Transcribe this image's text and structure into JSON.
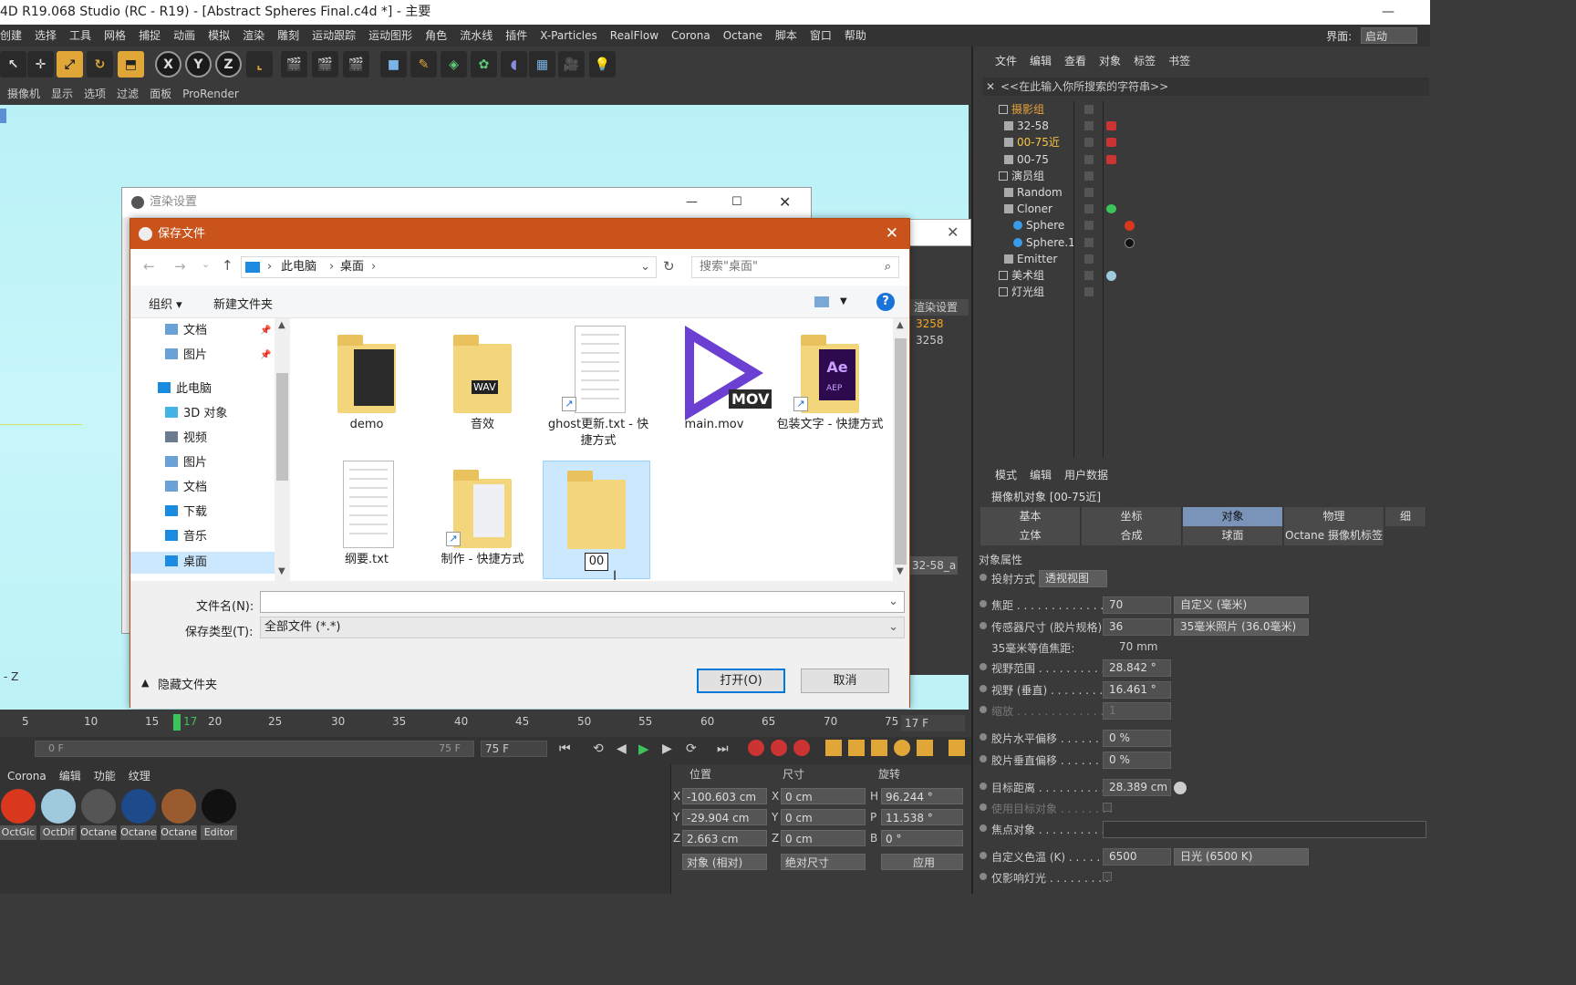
{
  "window": {
    "title": "4D R19.068 Studio (RC - R19) - [Abstract Spheres Final.c4d *] - 主要",
    "minimize": "—",
    "restore": "□"
  },
  "menu": {
    "items": [
      "创建",
      "选择",
      "工具",
      "网格",
      "捕捉",
      "动画",
      "模拟",
      "渲染",
      "雕刻",
      "运动跟踪",
      "运动图形",
      "角色",
      "流水线",
      "插件",
      "X-Particles",
      "RealFlow",
      "Corona",
      "Octane",
      "脚本",
      "窗口",
      "帮助"
    ],
    "layout_label": "界面:",
    "layout_value": "启动"
  },
  "toolbar": {
    "x": "X",
    "y": "Y",
    "z": "Z"
  },
  "viewmenu": [
    "摄像机",
    "显示",
    "选项",
    "过滤",
    "面板",
    "ProRender"
  ],
  "viewport": {
    "axis_label": "- Z"
  },
  "timeline": {
    "ticks": [
      "5",
      "10",
      "15",
      "17",
      "20",
      "25",
      "30",
      "35",
      "40",
      "45",
      "50",
      "55",
      "60",
      "65",
      "70",
      "75"
    ],
    "current_frame": "17 F",
    "range_start": "0 F",
    "range_end": "75 F",
    "end_field": "75 F"
  },
  "materials": {
    "menu": [
      "Corona",
      "编辑",
      "功能",
      "纹理"
    ],
    "items": [
      {
        "label": "OctGlc",
        "color": "#d9381e"
      },
      {
        "label": "OctDif",
        "color": "#9fc9dc"
      },
      {
        "label": "Octane",
        "color": "#555555"
      },
      {
        "label": "Octane",
        "color": "#1c4a8a"
      },
      {
        "label": "Octane",
        "color": "#9a5c2e"
      },
      {
        "label": "Editor",
        "color": "#111111"
      }
    ]
  },
  "coords": {
    "headers": {
      "pos": "位置",
      "size": "尺寸",
      "rot": "旋转"
    },
    "rows": [
      {
        "a": "X",
        "pos": "-100.603 cm",
        "b": "X",
        "size": "0 cm",
        "c": "H",
        "rot": "96.244 °"
      },
      {
        "a": "Y",
        "pos": "-29.904 cm",
        "b": "Y",
        "size": "0 cm",
        "c": "P",
        "rot": "11.538 °"
      },
      {
        "a": "Z",
        "pos": "2.663 cm",
        "b": "Z",
        "size": "0 cm",
        "c": "B",
        "rot": "0 °"
      }
    ],
    "mode": "对象 (相对)",
    "size_mode": "绝对尺寸",
    "apply": "应用"
  },
  "objects": {
    "menu": [
      "文件",
      "编辑",
      "查看",
      "对象",
      "标签",
      "书签"
    ],
    "search_placeholder": "<<在此输入你所搜索的字符串>>",
    "rows": [
      {
        "name": "摄影组",
        "color": "#e8a23a"
      },
      {
        "name": "32-58",
        "color": "#ddd"
      },
      {
        "name": "00-75近",
        "color": "#f5c542"
      },
      {
        "name": "00-75",
        "color": "#ddd"
      },
      {
        "name": "演员组",
        "color": "#ddd"
      },
      {
        "name": "Random",
        "color": "#ddd"
      },
      {
        "name": "Cloner",
        "color": "#ddd"
      },
      {
        "name": "Sphere",
        "color": "#ddd"
      },
      {
        "name": "Sphere.1",
        "color": "#ddd"
      },
      {
        "name": "Emitter",
        "color": "#ddd"
      },
      {
        "name": "美术组",
        "color": "#ddd"
      },
      {
        "name": "灯光组",
        "color": "#ddd"
      }
    ]
  },
  "render_settings": {
    "title": "渲染设置",
    "side_header": "渲染设置",
    "side_items": [
      "3258",
      "3258"
    ],
    "side_field": "32-58_a"
  },
  "save_dialog": {
    "title": "保存文件",
    "crumbs": [
      "此电脑",
      "桌面"
    ],
    "search_placeholder": "搜索\"桌面\"",
    "organize": "组织 ▾",
    "new_folder": "新建文件夹",
    "help": "?",
    "nav": [
      {
        "label": "文档",
        "pinned": true
      },
      {
        "label": "图片",
        "pinned": true
      },
      {
        "label": "此电脑"
      },
      {
        "label": "3D 对象"
      },
      {
        "label": "视频"
      },
      {
        "label": "图片"
      },
      {
        "label": "文档"
      },
      {
        "label": "下载"
      },
      {
        "label": "音乐"
      },
      {
        "label": "桌面",
        "selected": true
      }
    ],
    "files": [
      {
        "name": "demo",
        "kind": "folder"
      },
      {
        "name": "音效",
        "kind": "folder"
      },
      {
        "name": "ghost更新.txt - 快捷方式",
        "kind": "doc"
      },
      {
        "name": "main.mov",
        "kind": "mov"
      },
      {
        "name": "包装文字 - 快捷方式",
        "kind": "folder"
      },
      {
        "name": "纲要.txt",
        "kind": "doc"
      },
      {
        "name": "制作 - 快捷方式",
        "kind": "folder"
      },
      {
        "name": "00",
        "kind": "folder",
        "editing": true
      }
    ],
    "filename_label": "文件名(N):",
    "filename_value": "",
    "type_label": "保存类型(T):",
    "type_value": "全部文件 (*.*)",
    "hide_folders": "隐藏文件夹",
    "open": "打开(O)",
    "cancel": "取消",
    "mov_badge": "MOV",
    "wav_badge": "WAV",
    "ae_badge": "Ae",
    "aep_badge": "AEP"
  },
  "attributes": {
    "menu": [
      "模式",
      "编辑",
      "用户数据"
    ],
    "object_title": "摄像机对象 [00-75近]",
    "tabs_row1": [
      "基本",
      "坐标",
      "对象",
      "物理",
      "细"
    ],
    "tabs_row2": [
      "立体",
      "合成",
      "球面",
      "Octane 摄像机标签"
    ],
    "active_tab": "对象",
    "section": "对象属性",
    "props": [
      {
        "label": "投射方式",
        "value": "透视视图"
      },
      {
        "label": "焦距 . . . . . . . . . . . . . .",
        "value": "70",
        "extra": "自定义 (毫米)"
      },
      {
        "label": "传感器尺寸 (胶片规格)",
        "value": "36",
        "extra": "35毫米照片 (36.0毫米)"
      },
      {
        "label": "35毫米等值焦距:",
        "value": "70 mm"
      },
      {
        "label": "视野范围 . . . . . . . . . . .",
        "value": "28.842 °"
      },
      {
        "label": "视野 (垂直) . . . . . . . . .",
        "value": "16.461 °"
      },
      {
        "label": "缩放 . . . . . . . . . . . . . .",
        "value": "1"
      },
      {
        "label": "胶片水平偏移 . . . . . . . .",
        "value": "0 %"
      },
      {
        "label": "胶片垂直偏移 . . . . . . . .",
        "value": "0 %"
      },
      {
        "label": "目标距离 . . . . . . . . . . .",
        "value": "28.389 cm"
      },
      {
        "label": "使用目标对象 . . . . . . . .",
        "value": ""
      },
      {
        "label": "焦点对象 . . . . . . . . . . .",
        "value": ""
      },
      {
        "label": "自定义色温 (K) . . . . . .",
        "value": "6500",
        "extra": "日光 (6500 K)"
      },
      {
        "label": "仅影响灯光 . . . . . . . . .",
        "value": ""
      }
    ]
  }
}
